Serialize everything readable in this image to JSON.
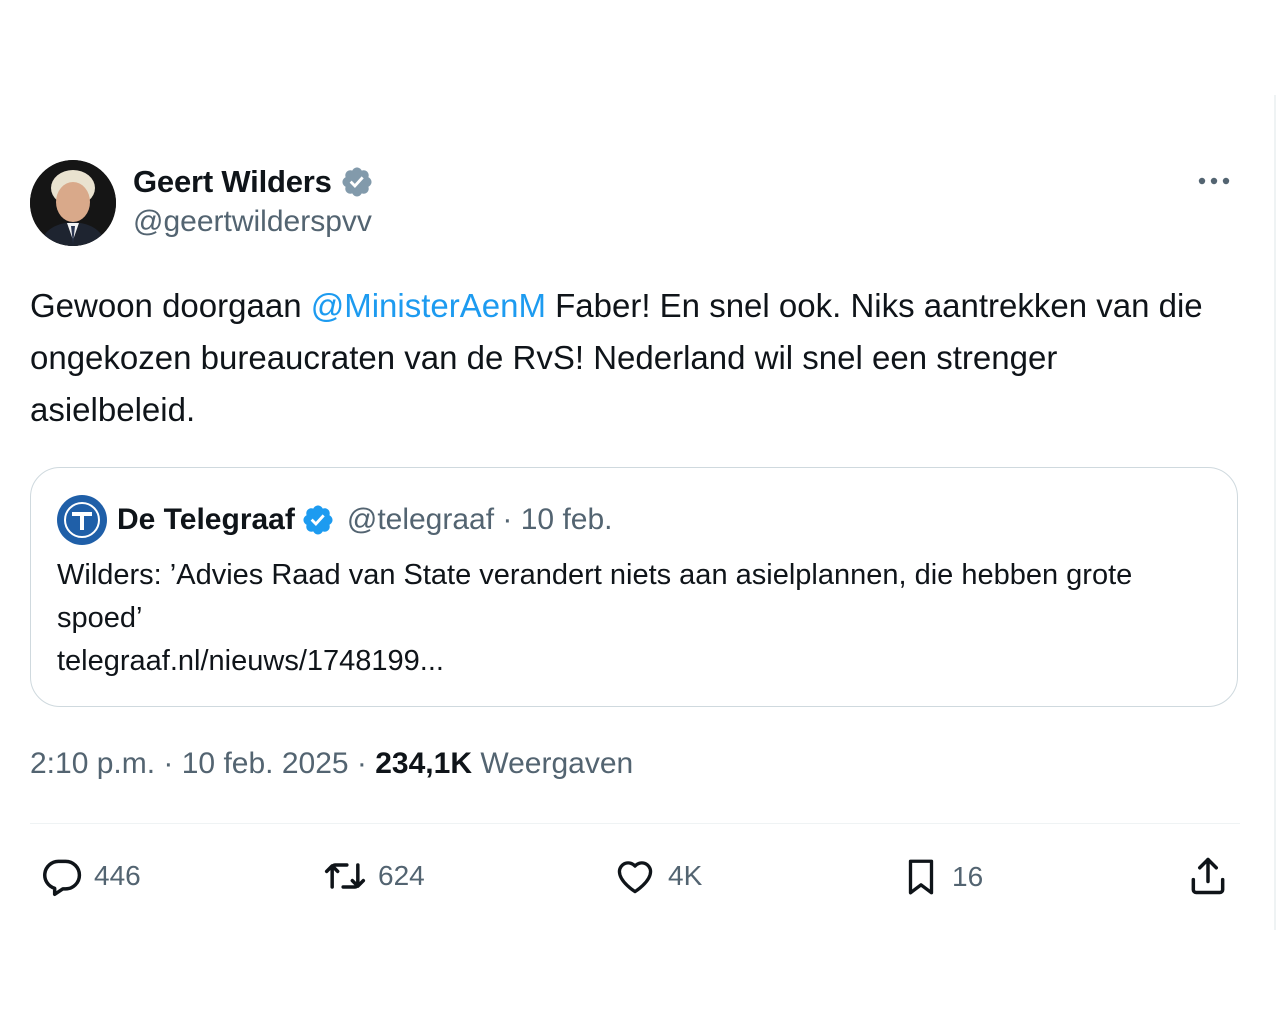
{
  "tweet": {
    "author_name": "Geert Wilders",
    "author_handle": "@geertwilderspvv",
    "text_before": "Gewoon doorgaan ",
    "mention": "@MinisterAenM",
    "text_after": " Faber! En snel ook. Niks aantrekken van die ongekozen bureaucraten van de RvS! Nederland wil snel een strenger asielbeleid.",
    "time": "2:10 p.m.",
    "date": "10 feb. 2025",
    "views_count": "234,1K",
    "views_label": "Weergaven"
  },
  "quote": {
    "name": "De Telegraaf",
    "handle": "@telegraaf",
    "date": "10 feb.",
    "text": "Wilders: ’Advies Raad van State verandert niets aan asielplannen, die hebben grote spoed’",
    "link": "telegraaf.nl/nieuws/1748199..."
  },
  "actions": {
    "replies": "446",
    "reposts": "624",
    "likes": "4K",
    "bookmarks": "16"
  },
  "colors": {
    "mention": "#1d9bf0",
    "secondary_text": "#536471",
    "verified_gray": "#829aab",
    "verified_blue": "#1d9bf0",
    "telegraaf_blue": "#1f5fa8"
  },
  "icons": [
    "verified-gray-icon",
    "more-icon",
    "verified-blue-icon",
    "reply-icon",
    "repost-icon",
    "like-icon",
    "bookmark-icon",
    "share-icon"
  ]
}
